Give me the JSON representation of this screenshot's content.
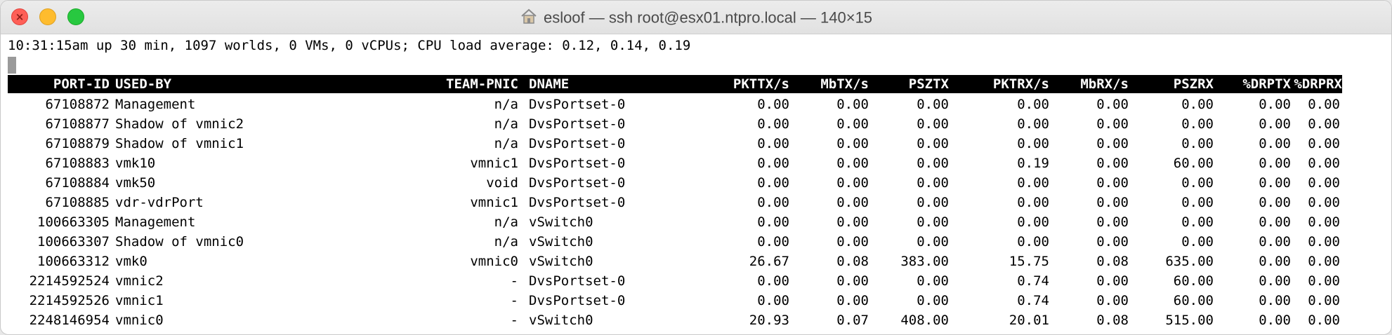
{
  "window": {
    "title": "esloof — ssh root@esx01.ntpro.local — 140×15",
    "title_icon": "home-icon"
  },
  "terminal": {
    "status_line": "10:31:15am up 30 min, 1097 worlds, 0 VMs, 0 vCPUs; CPU load average: 0.12, 0.14, 0.19",
    "columns": [
      "PORT-ID",
      "USED-BY",
      "TEAM-PNIC",
      "DNAME",
      "PKTTX/s",
      "MbTX/s",
      "PSZTX",
      "PKTRX/s",
      "MbRX/s",
      "PSZRX",
      "%DRPTX",
      "%DRPRX"
    ],
    "rows": [
      {
        "port_id": "67108872",
        "used_by": "Management",
        "team_pnic": "n/a",
        "dname": "DvsPortset-0",
        "pkttx": "0.00",
        "mbtx": "0.00",
        "psztx": "0.00",
        "pktrx": "0.00",
        "mbrx": "0.00",
        "pszrx": "0.00",
        "drptx": "0.00",
        "drprx": "0.00"
      },
      {
        "port_id": "67108877",
        "used_by": "Shadow of vmnic2",
        "team_pnic": "n/a",
        "dname": "DvsPortset-0",
        "pkttx": "0.00",
        "mbtx": "0.00",
        "psztx": "0.00",
        "pktrx": "0.00",
        "mbrx": "0.00",
        "pszrx": "0.00",
        "drptx": "0.00",
        "drprx": "0.00"
      },
      {
        "port_id": "67108879",
        "used_by": "Shadow of vmnic1",
        "team_pnic": "n/a",
        "dname": "DvsPortset-0",
        "pkttx": "0.00",
        "mbtx": "0.00",
        "psztx": "0.00",
        "pktrx": "0.00",
        "mbrx": "0.00",
        "pszrx": "0.00",
        "drptx": "0.00",
        "drprx": "0.00"
      },
      {
        "port_id": "67108883",
        "used_by": "vmk10",
        "team_pnic": "vmnic1",
        "dname": "DvsPortset-0",
        "pkttx": "0.00",
        "mbtx": "0.00",
        "psztx": "0.00",
        "pktrx": "0.19",
        "mbrx": "0.00",
        "pszrx": "60.00",
        "drptx": "0.00",
        "drprx": "0.00"
      },
      {
        "port_id": "67108884",
        "used_by": "vmk50",
        "team_pnic": "void",
        "dname": "DvsPortset-0",
        "pkttx": "0.00",
        "mbtx": "0.00",
        "psztx": "0.00",
        "pktrx": "0.00",
        "mbrx": "0.00",
        "pszrx": "0.00",
        "drptx": "0.00",
        "drprx": "0.00"
      },
      {
        "port_id": "67108885",
        "used_by": "vdr-vdrPort",
        "team_pnic": "vmnic1",
        "dname": "DvsPortset-0",
        "pkttx": "0.00",
        "mbtx": "0.00",
        "psztx": "0.00",
        "pktrx": "0.00",
        "mbrx": "0.00",
        "pszrx": "0.00",
        "drptx": "0.00",
        "drprx": "0.00"
      },
      {
        "port_id": "100663305",
        "used_by": "Management",
        "team_pnic": "n/a",
        "dname": "vSwitch0",
        "pkttx": "0.00",
        "mbtx": "0.00",
        "psztx": "0.00",
        "pktrx": "0.00",
        "mbrx": "0.00",
        "pszrx": "0.00",
        "drptx": "0.00",
        "drprx": "0.00"
      },
      {
        "port_id": "100663307",
        "used_by": "Shadow of vmnic0",
        "team_pnic": "n/a",
        "dname": "vSwitch0",
        "pkttx": "0.00",
        "mbtx": "0.00",
        "psztx": "0.00",
        "pktrx": "0.00",
        "mbrx": "0.00",
        "pszrx": "0.00",
        "drptx": "0.00",
        "drprx": "0.00"
      },
      {
        "port_id": "100663312",
        "used_by": "vmk0",
        "team_pnic": "vmnic0",
        "dname": "vSwitch0",
        "pkttx": "26.67",
        "mbtx": "0.08",
        "psztx": "383.00",
        "pktrx": "15.75",
        "mbrx": "0.08",
        "pszrx": "635.00",
        "drptx": "0.00",
        "drprx": "0.00"
      },
      {
        "port_id": "2214592524",
        "used_by": "vmnic2",
        "team_pnic": "-",
        "dname": "DvsPortset-0",
        "pkttx": "0.00",
        "mbtx": "0.00",
        "psztx": "0.00",
        "pktrx": "0.74",
        "mbrx": "0.00",
        "pszrx": "60.00",
        "drptx": "0.00",
        "drprx": "0.00"
      },
      {
        "port_id": "2214592526",
        "used_by": "vmnic1",
        "team_pnic": "-",
        "dname": "DvsPortset-0",
        "pkttx": "0.00",
        "mbtx": "0.00",
        "psztx": "0.00",
        "pktrx": "0.74",
        "mbrx": "0.00",
        "pszrx": "60.00",
        "drptx": "0.00",
        "drprx": "0.00"
      },
      {
        "port_id": "2248146954",
        "used_by": "vmnic0",
        "team_pnic": "-",
        "dname": "vSwitch0",
        "pkttx": "20.93",
        "mbtx": "0.07",
        "psztx": "408.00",
        "pktrx": "20.01",
        "mbrx": "0.08",
        "pszrx": "515.00",
        "drptx": "0.00",
        "drprx": "0.00"
      }
    ]
  },
  "colors": {
    "header_bg": "#000000",
    "header_fg": "#ffffff",
    "close": "#fe5f57",
    "minimize": "#febc2e",
    "maximize": "#28c840"
  }
}
